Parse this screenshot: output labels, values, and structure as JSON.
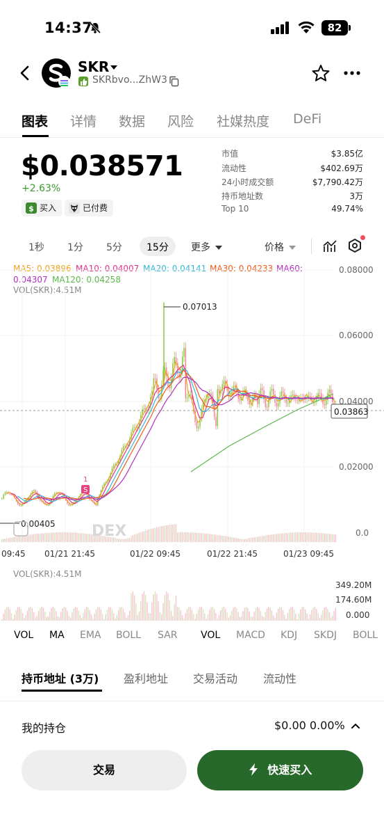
{
  "status_bar": {
    "time": "14:37",
    "battery": "82"
  },
  "token": {
    "name": "SKR",
    "address": "SKRbvo...ZhW3"
  },
  "tabs": [
    "图表",
    "详情",
    "数据",
    "风险",
    "社媒热度",
    "DeFi"
  ],
  "price": {
    "value": "$0.038571",
    "change": "+2.63%"
  },
  "badges": {
    "buy": "买入",
    "paid": "已付费"
  },
  "stats": [
    {
      "label": "市值",
      "value": "$3.85亿"
    },
    {
      "label": "流动性",
      "value": "$402.69万"
    },
    {
      "label": "24小时成交额",
      "value": "$7,790.42万"
    },
    {
      "label": "持币地址数",
      "value": "3万"
    },
    {
      "label": "Top 10",
      "value": "49.74%"
    }
  ],
  "timeframes": [
    "1秒",
    "1分",
    "5分",
    "15分"
  ],
  "timeframe_more": "更多",
  "price_selector": "价格",
  "ma_legend": {
    "ma5": "MA5: 0.03896",
    "ma10": "MA10: 0.04007",
    "ma20": "MA20: 0.04141",
    "ma30": "MA30: 0.04233",
    "ma60a": "MA60:",
    "ma60b": "0.04307",
    "ma120": "MA120: 0.04258",
    "vol": "VOL(SKR):4.51M"
  },
  "chart": {
    "y_ticks": [
      "0.08000",
      "0.06000",
      "0.04000",
      "0.02000",
      "0.0"
    ],
    "x_ticks": [
      "09:45",
      "01/21 21:45",
      "01/22 09:45",
      "01/22 21:45",
      "01/23 09:45"
    ],
    "high_label": "0.07013",
    "low_label": "0.00405",
    "current_label": "0.03863",
    "marker_count": "1",
    "marker_letter": "S",
    "watermark": "DEX",
    "vol_label": "VOL(SKR):4.51M",
    "vol_ticks": [
      "349.20M",
      "174.60M",
      "0.000"
    ],
    "colors": {
      "ma5": "#f0a21d",
      "ma10": "#e0338b",
      "ma20": "#33b6d6",
      "ma30": "#f05a14",
      "ma60": "#b12fbe",
      "ma120": "#5bb84a",
      "up": "#8fc94b",
      "down": "#f08a9d"
    }
  },
  "indicators": [
    "VOL",
    "MA",
    "EMA",
    "BOLL",
    "SAR",
    "VOL",
    "MACD",
    "KDJ",
    "SKDJ",
    "BOLL"
  ],
  "holder_tabs": [
    "持币地址 (3万)",
    "盈利地址",
    "交易活动",
    "流动性"
  ],
  "my_position": {
    "label": "我的持仓",
    "value": "$0.00 0.00%"
  },
  "buttons": {
    "trade": "交易",
    "quick_buy": "快速买入"
  }
}
